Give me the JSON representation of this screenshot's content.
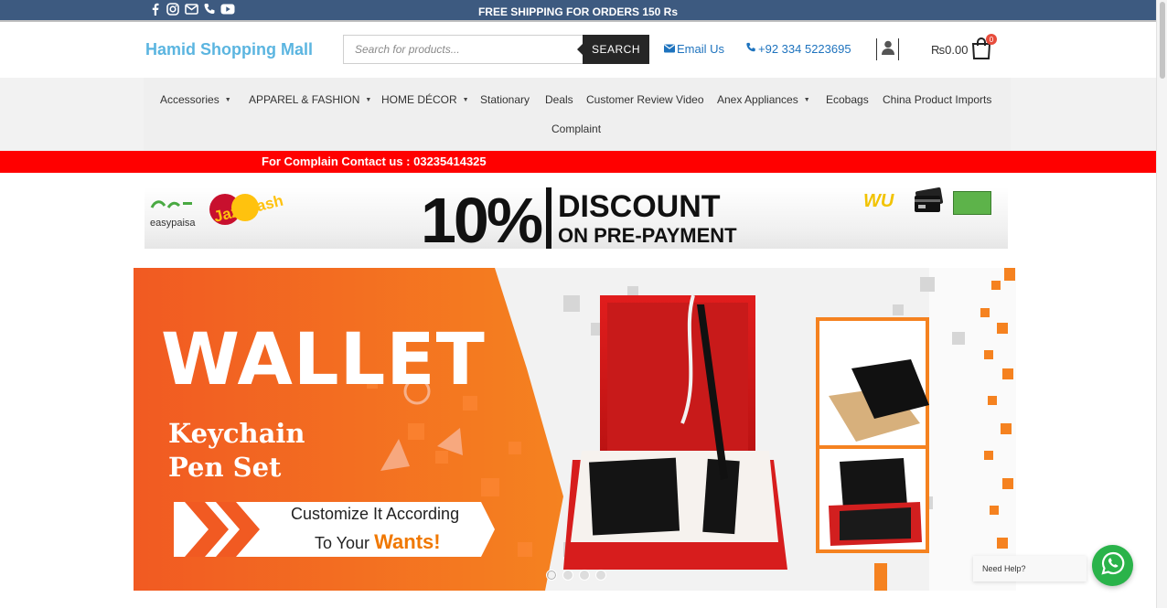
{
  "topbar": {
    "shipping": "FREE SHIPPING FOR ORDERS 150 Rs",
    "socials": [
      "facebook-icon",
      "instagram-icon",
      "mail-icon",
      "phone-icon",
      "youtube-icon"
    ]
  },
  "header": {
    "brand": "Hamid Shopping Mall",
    "search_placeholder": "Search for products...",
    "search_button": "SEARCH",
    "email_label": "Email Us",
    "phone_label": "+92 334 5223695",
    "cart_total": "₨0.00",
    "cart_count": "0"
  },
  "nav": {
    "items": [
      {
        "label": "Accessories",
        "dropdown": true
      },
      {
        "label": "APPAREL & FASHION",
        "dropdown": true
      },
      {
        "label": "HOME DÉCOR",
        "dropdown": true
      },
      {
        "label": "Stationary",
        "dropdown": false
      },
      {
        "label": "Deals",
        "dropdown": false
      },
      {
        "label": "Customer Review Video",
        "dropdown": false
      },
      {
        "label": "Anex Appliances",
        "dropdown": true
      },
      {
        "label": "Ecobags",
        "dropdown": false
      },
      {
        "label": "China Product Imports",
        "dropdown": false
      },
      {
        "label": "Complaint",
        "dropdown": false
      }
    ]
  },
  "complaint_bar": {
    "text": "For Complain Contact us : 03235414325"
  },
  "discount_banner": {
    "easypaisa": "easypaisa",
    "jazzcash": "JazzCash",
    "percent": "10%",
    "line1": "DISCOUNT",
    "line2": "ON PRE-PAYMENT",
    "wu": "WU"
  },
  "hero": {
    "title": "WALLET",
    "subtitle_line1": "Keychain",
    "subtitle_line2": "Pen Set",
    "cta_line1": "Customize It According",
    "cta_line2_prefix": "To Your",
    "cta_line2_highlight": "Wants!",
    "slides": 4,
    "active_slide": 1
  },
  "help": {
    "label": "Need Help?"
  },
  "colors": {
    "topbar": "#3d5a80",
    "brand": "#5bb5e0",
    "link": "#1e73be",
    "complaint": "#ff0000",
    "hero_orange": "#f06a1a",
    "whatsapp": "#2ab34a"
  }
}
